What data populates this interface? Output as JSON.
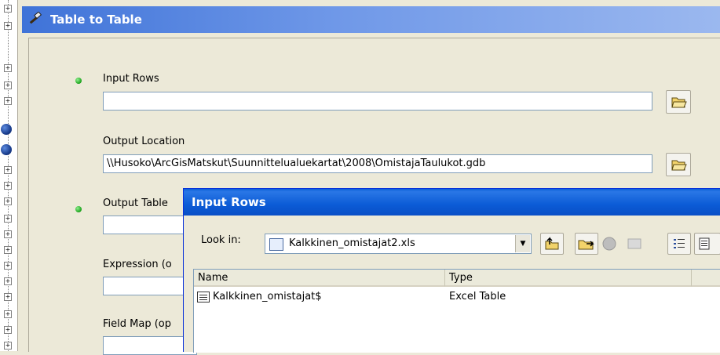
{
  "tool": {
    "title": "Table to Table"
  },
  "params": [
    {
      "label": "Input Rows",
      "value": "",
      "required": true
    },
    {
      "label": "Output Location",
      "value": "\\\\Husoko\\ArcGisMatskut\\Suunnittelualuekartat\\2008\\OmistajaTaulukot.gdb",
      "required": false
    },
    {
      "label": "Output Table",
      "value": "",
      "required": true
    },
    {
      "label": "Expression (o",
      "value": "",
      "required": false
    },
    {
      "label": "Field Map (op",
      "value": "",
      "required": false
    }
  ],
  "dialog": {
    "title": "Input Rows",
    "look_in_label": "Look in:",
    "look_in_value": "Kalkkinen_omistajat2.xls",
    "columns": [
      "Name",
      "Type"
    ],
    "rows": [
      {
        "name": "Kalkkinen_omistajat$",
        "type": "Excel Table"
      }
    ]
  },
  "colors": {
    "title_bar": "#3f73d8",
    "dialog_title": "#0a5fd8",
    "required_dot": "#19a019"
  },
  "icons": [
    "hammer-icon",
    "folder-open-icon",
    "up-folder-icon",
    "connect-folder-icon",
    "globe-icon",
    "list-view-icon",
    "details-view-icon"
  ]
}
